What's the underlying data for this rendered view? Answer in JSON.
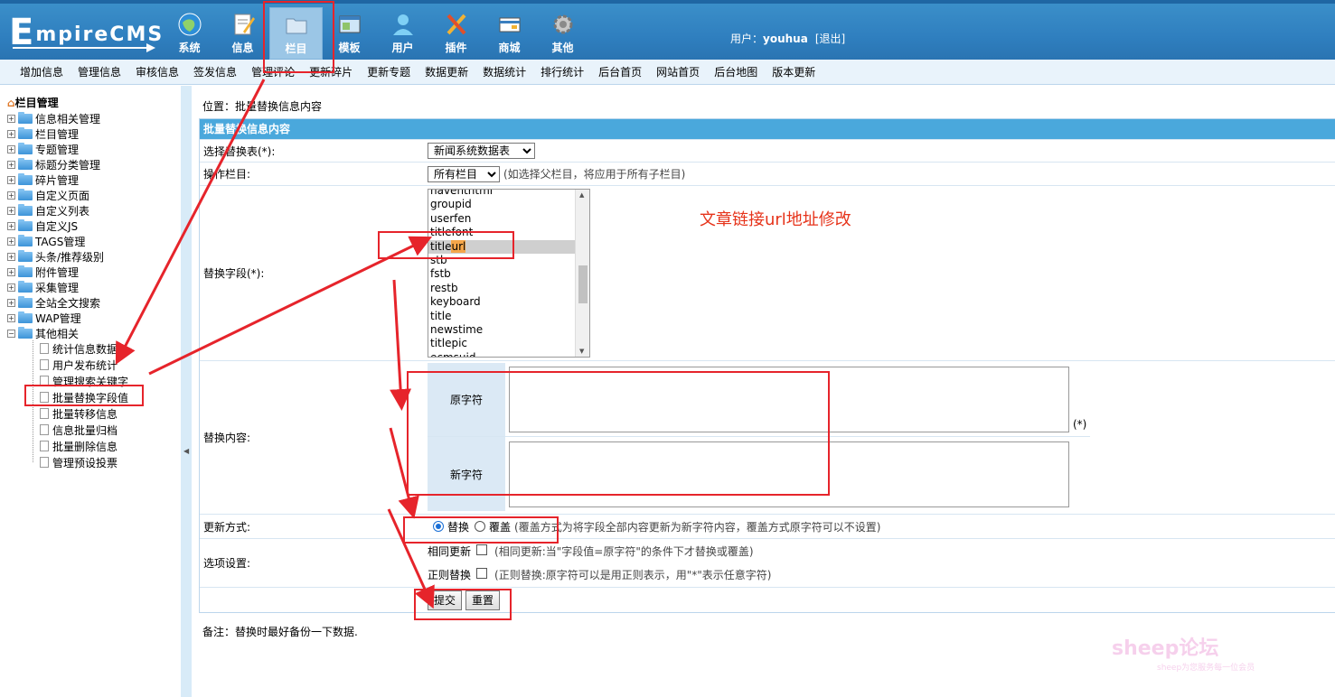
{
  "header": {
    "logo_main": "E",
    "logo_rest": "mpireCMS",
    "nav": [
      {
        "label": "系统",
        "icon": "globe-icon"
      },
      {
        "label": "信息",
        "icon": "document-edit-icon"
      },
      {
        "label": "栏目",
        "icon": "folder-icon"
      },
      {
        "label": "模板",
        "icon": "template-icon"
      },
      {
        "label": "用户",
        "icon": "user-icon"
      },
      {
        "label": "插件",
        "icon": "tools-icon"
      },
      {
        "label": "商城",
        "icon": "card-icon"
      },
      {
        "label": "其他",
        "icon": "gear-icon"
      }
    ],
    "user_prefix": "用户：",
    "username": "youhua",
    "logout": "[退出]"
  },
  "subnav": [
    "增加信息",
    "管理信息",
    "审核信息",
    "签发信息",
    "管理评论",
    "更新碎片",
    "更新专题",
    "数据更新",
    "数据统计",
    "排行统计",
    "后台首页",
    "网站首页",
    "后台地图",
    "版本更新"
  ],
  "sidebar": {
    "root": "栏目管理",
    "items": [
      "信息相关管理",
      "栏目管理",
      "专题管理",
      "标题分类管理",
      "碎片管理",
      "自定义页面",
      "自定义列表",
      "自定义JS",
      "TAGS管理",
      "头条/推荐级别",
      "附件管理",
      "采集管理",
      "全站全文搜索",
      "WAP管理",
      "其他相关"
    ],
    "subitems": [
      "统计信息数据",
      "用户发布统计",
      "管理搜索关键字",
      "批量替换字段值",
      "批量转移信息",
      "信息批量归档",
      "批量删除信息",
      "管理预设投票"
    ]
  },
  "main": {
    "breadcrumb": "位置：批量替换信息内容",
    "form_title": "批量替换信息内容",
    "table_label": "选择替换表(*):",
    "table_value": "新闻系统数据表",
    "column_label": "操作栏目:",
    "column_value": "所有栏目",
    "column_hint": "(如选择父栏目，将应用于所有子栏目)",
    "field_label": "替换字段(*):",
    "fields": [
      "haventhtml",
      "groupid",
      "userfen",
      "titlefont",
      "title",
      "stb",
      "fstb",
      "restb",
      "keyboard",
      "title",
      "newstime",
      "titlepic",
      "ecmsuid"
    ],
    "selected_field_hl": "url",
    "annotation": "文章链接url地址修改",
    "content_label": "替换内容:",
    "old_label": "原字符",
    "new_label": "新字符",
    "required_mark": "(*)",
    "mode_label": "更新方式:",
    "mode_replace": "替换",
    "mode_cover": "覆盖",
    "mode_hint": "(覆盖方式为将字段全部内容更新为新字符内容，覆盖方式原字符可以不设置)",
    "options_label": "选项设置:",
    "opt_same": "相同更新",
    "opt_same_hint": "(相同更新:当\"字段值=原字符\"的条件下才替换或覆盖)",
    "opt_regex": "正则替换",
    "opt_regex_hint": "(正则替换:原字符可以是用正则表示，用\"*\"表示任意字符)",
    "submit": "提交",
    "reset": "重置",
    "note": "备注：替换时最好备份一下数据."
  },
  "watermark": "sheep论坛",
  "watermark_sub": "sheep为您服务每一位会员",
  "colors": {
    "header": "#2f7fbf",
    "accent": "#4aa8dc",
    "annotation": "#e6242b"
  }
}
